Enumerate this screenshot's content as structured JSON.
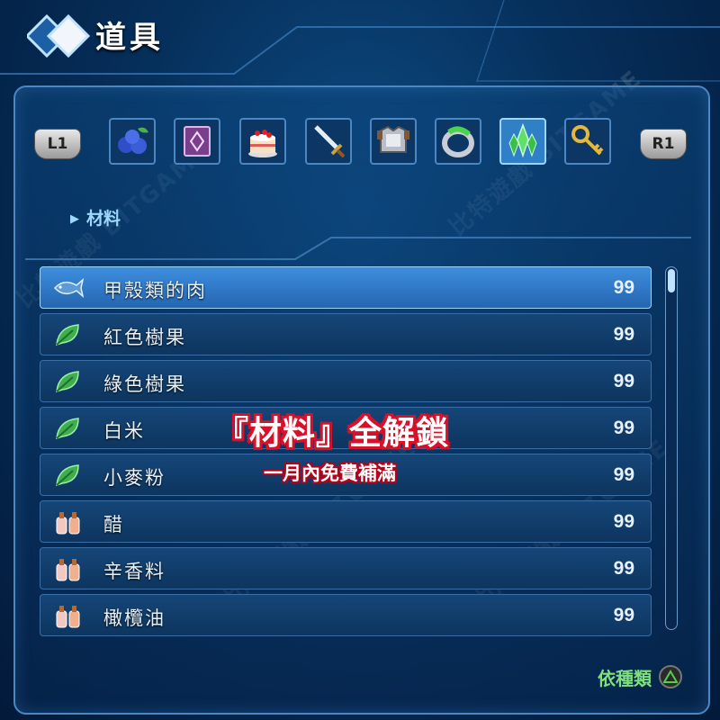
{
  "header": {
    "title": "道具"
  },
  "shoulder": {
    "left": "L1",
    "right": "R1"
  },
  "tabs": [
    {
      "name": "blueberry-icon",
      "active": false
    },
    {
      "name": "book-icon",
      "active": false
    },
    {
      "name": "cake-icon",
      "active": false
    },
    {
      "name": "sword-icon",
      "active": false
    },
    {
      "name": "armor-icon",
      "active": false
    },
    {
      "name": "ring-icon",
      "active": false
    },
    {
      "name": "crystal-icon",
      "active": true
    },
    {
      "name": "key-icon",
      "active": false
    }
  ],
  "category": {
    "label": "材料"
  },
  "items": [
    {
      "name": "甲殼類的肉",
      "qty": "99",
      "icon": "fish-icon",
      "selected": true
    },
    {
      "name": "紅色樹果",
      "qty": "99",
      "icon": "leaf-icon",
      "selected": false
    },
    {
      "name": "綠色樹果",
      "qty": "99",
      "icon": "leaf-icon",
      "selected": false
    },
    {
      "name": "白米",
      "qty": "99",
      "icon": "leaf-icon",
      "selected": false
    },
    {
      "name": "小麥粉",
      "qty": "99",
      "icon": "leaf-icon",
      "selected": false
    },
    {
      "name": "醋",
      "qty": "99",
      "icon": "bottles-icon",
      "selected": false
    },
    {
      "name": "辛香料",
      "qty": "99",
      "icon": "bottles-icon",
      "selected": false
    },
    {
      "name": "橄欖油",
      "qty": "99",
      "icon": "bottles-icon",
      "selected": false
    }
  ],
  "sort": {
    "label": "依種類"
  },
  "promo": {
    "title": "『材料』全解鎖",
    "subtitle": "一月內免費補滿"
  },
  "watermark": {
    "text": "比特遊戲 BITGAME"
  },
  "colors": {
    "accent": "#2f80c6",
    "promo_red": "#d8102a",
    "sort_green": "#7fe07f"
  }
}
